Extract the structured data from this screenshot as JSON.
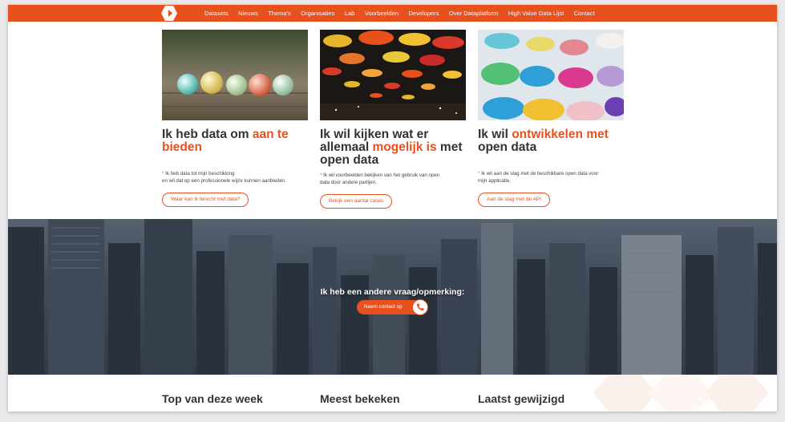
{
  "nav": {
    "items": [
      "Datasets",
      "Nieuws",
      "Thema's",
      "Organisaties",
      "Lab",
      "Voorbeelden",
      "Developers",
      "Over Dataplatform",
      "High Value Data Lijst",
      "Contact"
    ]
  },
  "colors": {
    "accent": "#e8501d"
  },
  "cards": [
    {
      "title_pre": "Ik heb data om ",
      "title_hl": "aan te bieden",
      "title_post": "",
      "desc_line1": "Ik heb data tot mijn beschikking",
      "desc_line2": "en wil dat op een professionele wijze kunnen aanbieden.",
      "button": "Waar kan ik terecht met data?"
    },
    {
      "title_pre": "Ik wil kijken wat er allemaal ",
      "title_hl": "mogelijk is",
      "title_post": " met open data",
      "desc_line1": "Ik wil voorbeelden bekijken van het gebruik van open",
      "desc_line2": "data door andere partijen.",
      "button": "Bekijk een aantal cases"
    },
    {
      "title_pre": "Ik wil ",
      "title_hl": "ontwikkelen met",
      "title_post": " open data",
      "desc_line1": "Ik wil aan de slag met de beschikbare open data voor",
      "desc_line2": "mijn applicatie.",
      "button": "Aan de slag met de API"
    }
  ],
  "banner": {
    "title": "Ik heb een andere vraag/opmerking:",
    "button": "Neem contact op"
  },
  "sections": {
    "top_week": "Top van deze week",
    "most_viewed": "Meest bekeken",
    "last_modified": "Laatst gewijzigd"
  }
}
